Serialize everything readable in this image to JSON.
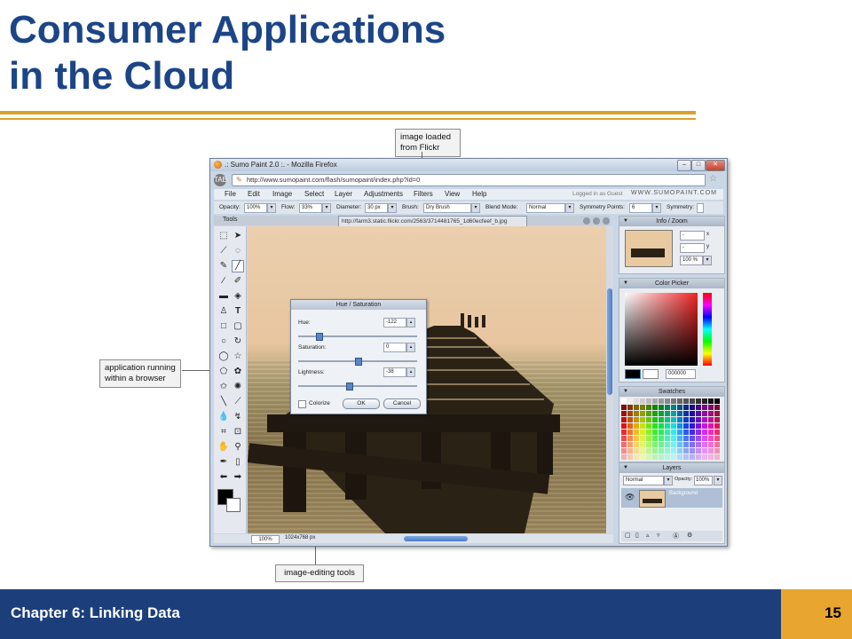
{
  "slide": {
    "title_line1": "Consumer Applications",
    "title_line2": "in the Cloud",
    "footer_text": "Chapter 6: Linking Data",
    "page_number": "15"
  },
  "callouts": {
    "flickr": "image loaded from Flickr",
    "browser": "application running within a browser",
    "tools": "image-editing tools"
  },
  "browser": {
    "title": ".: Sumo Paint 2.0 :. - Mozilla Firefox",
    "url": "http://www.sumopaint.com/flash/sumopaint/index.php?id=0",
    "back_label": "TAB"
  },
  "app": {
    "menus": [
      "File",
      "Edit",
      "Image",
      "Select",
      "Layer",
      "Adjustments",
      "Filters",
      "View",
      "Help"
    ],
    "guest_status": "Logged in as Guest",
    "brand": "WWW.SUMOPAINT.COM",
    "options": {
      "opacity_label": "Opacity:",
      "opacity_value": "100%",
      "flow_label": "Flow:",
      "flow_value": "33%",
      "diameter_label": "Diameter:",
      "diameter_value": "30 px",
      "brush_label": "Brush:",
      "brush_value": "Dry Brush",
      "blend_label": "Blend Mode:",
      "blend_value": "Normal",
      "sym_points_label": "Symmetry Points:",
      "sym_points_value": "6",
      "symmetry_label": "Symmetry:"
    },
    "tools_title": "Tools",
    "image_url": "http://farm3.static.flickr.com/2563/3714481765_1d60ecfeef_b.jpg",
    "status": {
      "zoom": "100%",
      "size": "1024x768 px"
    }
  },
  "dialog": {
    "title": "Hue / Saturation",
    "hue_label": "Hue:",
    "hue_value": "-122",
    "hue_level": 0.16,
    "saturation_label": "Saturation:",
    "saturation_value": "0",
    "saturation_level": 0.5,
    "lightness_label": "Lightness:",
    "lightness_value": "-38",
    "lightness_level": 0.42,
    "colorize_label": "Colorize",
    "ok_label": "OK",
    "cancel_label": "Cancel"
  },
  "panels": {
    "info_title": "Info / Zoom",
    "info_x": "-",
    "info_y": "-",
    "x_label": "x",
    "y_label": "y",
    "info_zoom": "100 %",
    "color_title": "Color Picker",
    "color_hex": "000000",
    "swatches_title": "Swatches",
    "layers_title": "Layers",
    "layers_mode": "Normal",
    "layers_opacity_label": "Opacity:",
    "layers_opacity_value": "100%",
    "layer_name": "Background"
  },
  "colors": {
    "title_blue": "#1c4587",
    "gold": "#d7a22a",
    "footer_blue": "#1c3f7c",
    "page_orange": "#e8a530"
  }
}
